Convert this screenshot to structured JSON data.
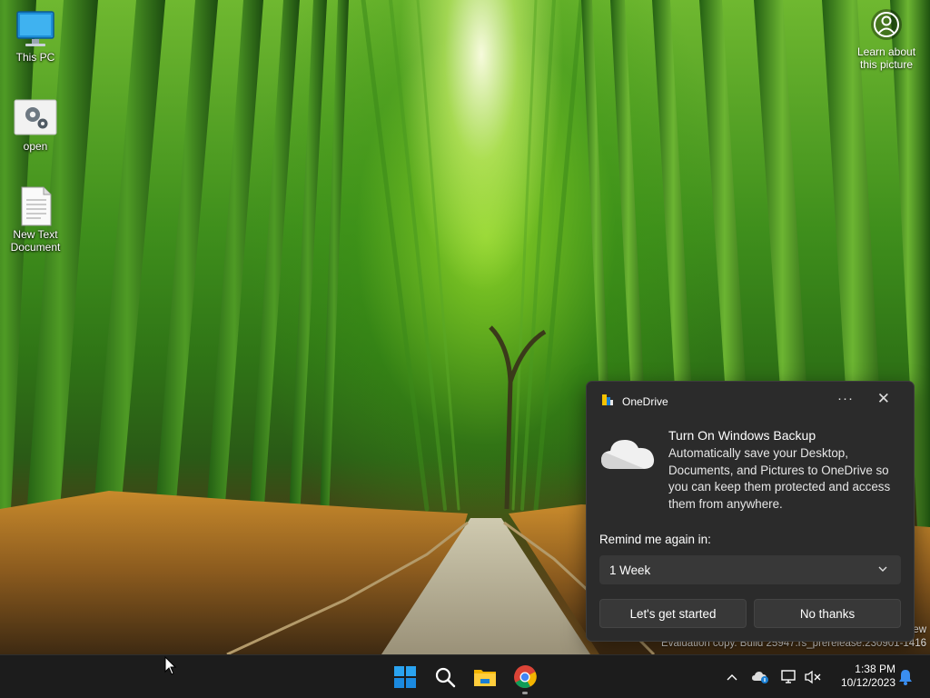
{
  "desktop": {
    "icons": [
      {
        "label": "This PC",
        "icon": "monitor-icon"
      },
      {
        "label": "open",
        "icon": "settings-gears-icon"
      },
      {
        "label": "New Text\nDocument",
        "icon": "text-document-icon"
      }
    ],
    "learn_about": {
      "label": "Learn about\nthis picture",
      "icon": "camera-info-icon"
    },
    "watermark": {
      "line1": "ew",
      "line2": "Evaluation copy. Build 25947.rs_prerelease.230901-1416"
    }
  },
  "toast": {
    "app_name": "OneDrive",
    "app_icon": "onedrive-icon",
    "more_label": "···",
    "close_label": "✕",
    "title": "Turn On Windows Backup",
    "body": "Automatically save your Desktop, Documents, and Pictures to OneDrive so you can keep them protected and access them from anywhere.",
    "remind_label": "Remind me again in:",
    "remind_selected": "1 Week",
    "primary_button": "Let's get started",
    "secondary_button": "No thanks"
  },
  "taskbar": {
    "apps": [
      "start-icon",
      "search-icon",
      "file-explorer-icon",
      "chrome-icon"
    ],
    "tray": [
      "chevron-up-icon",
      "onedrive-tray-icon",
      "network-icon",
      "volume-muted-icon"
    ],
    "time": "1:38 PM",
    "date": "10/12/2023",
    "notification_icon": "bell-icon"
  },
  "colors": {
    "toast_bg": "#2b2b2b",
    "control_bg": "#383838",
    "taskbar_bg": "#1c1c1c",
    "windows_blue": "#0078d4"
  }
}
